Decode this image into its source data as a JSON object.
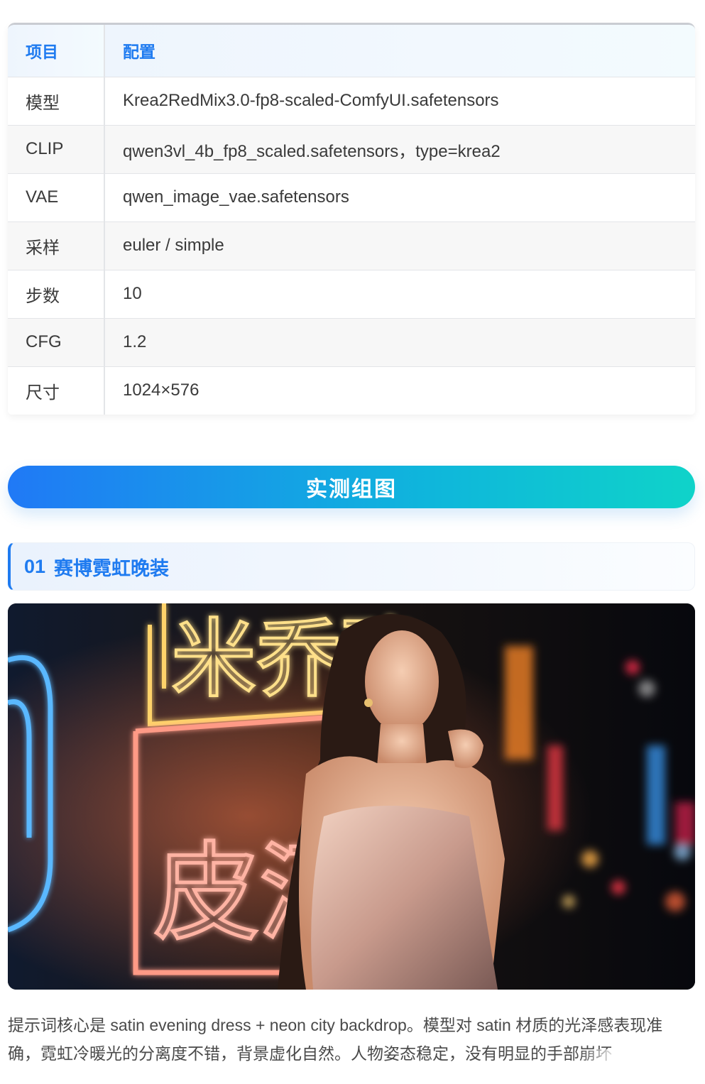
{
  "config_table": {
    "header": {
      "item": "项目",
      "config": "配置"
    },
    "rows": [
      {
        "item": "模型",
        "value": "Krea2RedMix3.0-fp8-scaled-ComfyUI.safetensors"
      },
      {
        "item": "CLIP",
        "value": "qwen3vl_4b_fp8_scaled.safetensors，type=krea2"
      },
      {
        "item": "VAE",
        "value": "qwen_image_vae.safetensors"
      },
      {
        "item": "采样",
        "value": "euler / simple"
      },
      {
        "item": "步数",
        "value": "10"
      },
      {
        "item": "CFG",
        "value": "1.2"
      },
      {
        "item": "尺寸",
        "value": "1024×576"
      }
    ]
  },
  "banner": {
    "title": "实测组图"
  },
  "section": {
    "number": "01",
    "title": "赛博霓虹晚装"
  },
  "photo": {
    "neon_sign_top": "米乔豫",
    "neon_sign_bottom": "皮酒"
  },
  "caption": {
    "text": "提示词核心是 satin evening dress + neon city backdrop。模型对 satin 材质的光泽感表现准确，霓虹冷暖光的分离度不错，背景虚化自然。人物姿态稳定，没有明显的手部崩坏"
  },
  "colors": {
    "accent": "#1f7bf0",
    "banner_start": "#2079f6",
    "banner_end": "#0fd3c9"
  }
}
